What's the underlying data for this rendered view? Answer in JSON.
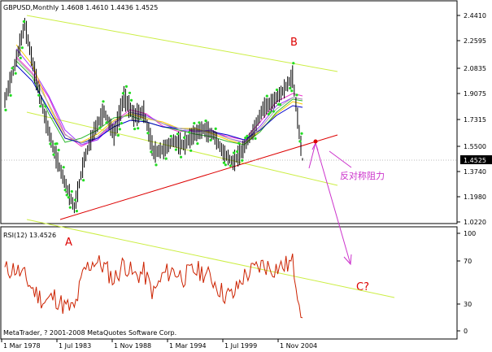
{
  "header": {
    "symbol_line": "GBPUSD,Monthly  1.4608 1.4610 1.4436 1.4525"
  },
  "price_axis": {
    "ticks": [
      "2.4410",
      "2.2595",
      "2.0835",
      "1.9075",
      "1.7315",
      "1.5500",
      "1.3740",
      "1.1980",
      "1.0220"
    ],
    "current_price": "1.4525"
  },
  "rsi_panel": {
    "label": "RSI(12) 13.4526",
    "ticks": [
      "100",
      "70",
      "30",
      "0"
    ],
    "copyright": "MetaTrader, ? 2001-2008 MetaQuotes Software Corp."
  },
  "time_axis": {
    "ticks": [
      "1 Mar 1978",
      "1 Jul 1983",
      "1 Nov 1988",
      "1 Mar 1994",
      "1 Jul 1999",
      "1 Nov 2004"
    ]
  },
  "annotations": {
    "point_a": "A",
    "point_b": "B",
    "point_c": "C?",
    "resistance_note": "反对称阻力"
  },
  "colors": {
    "background": "#ffffff",
    "price_bars": "#000000",
    "trendline_upper": "#ccee44",
    "trendline_support": "#dd0000",
    "annotation_red": "#dd0000",
    "annotation_magenta": "#cc33cc",
    "fractal_dots": "#22dd22",
    "rsi_line": "#cc2200",
    "current_price_box": "#000000"
  },
  "chart_data": [
    {
      "type": "ohlc",
      "symbol": "GBPUSD",
      "timeframe": "Monthly",
      "last_bar": {
        "open": 1.4608,
        "high": 1.461,
        "low": 1.4436,
        "close": 1.4525
      },
      "ylim": [
        1.022,
        2.441
      ],
      "x": [
        "1978",
        "1979",
        "1980",
        "1981",
        "1982",
        "1983",
        "1984",
        "1985",
        "1986",
        "1987",
        "1988",
        "1989",
        "1990",
        "1991",
        "1992",
        "1993",
        "1994",
        "1995",
        "1996",
        "1997",
        "1998",
        "1999",
        "2000",
        "2001",
        "2002",
        "2003",
        "2004",
        "2005",
        "2006",
        "2007",
        "2008"
      ],
      "close": [
        1.86,
        2.1,
        2.38,
        2.05,
        1.75,
        1.5,
        1.3,
        1.12,
        1.45,
        1.65,
        1.78,
        1.62,
        1.88,
        1.75,
        1.78,
        1.5,
        1.52,
        1.58,
        1.55,
        1.62,
        1.66,
        1.62,
        1.5,
        1.43,
        1.52,
        1.64,
        1.8,
        1.85,
        1.92,
        2.02,
        1.45
      ]
    },
    {
      "type": "line",
      "name": "RSI(12)",
      "ylim": [
        0,
        100
      ],
      "x": [
        "1978",
        "1979",
        "1980",
        "1981",
        "1982",
        "1983",
        "1984",
        "1985",
        "1986",
        "1987",
        "1988",
        "1989",
        "1990",
        "1991",
        "1992",
        "1993",
        "1994",
        "1995",
        "1996",
        "1997",
        "1998",
        "1999",
        "2000",
        "2001",
        "2002",
        "2003",
        "2004",
        "2005",
        "2006",
        "2007",
        "2008"
      ],
      "values": [
        62,
        64,
        55,
        40,
        30,
        35,
        25,
        22,
        62,
        72,
        66,
        52,
        70,
        56,
        60,
        38,
        58,
        62,
        55,
        62,
        60,
        52,
        38,
        36,
        55,
        62,
        68,
        64,
        66,
        70,
        13.45
      ]
    }
  ]
}
